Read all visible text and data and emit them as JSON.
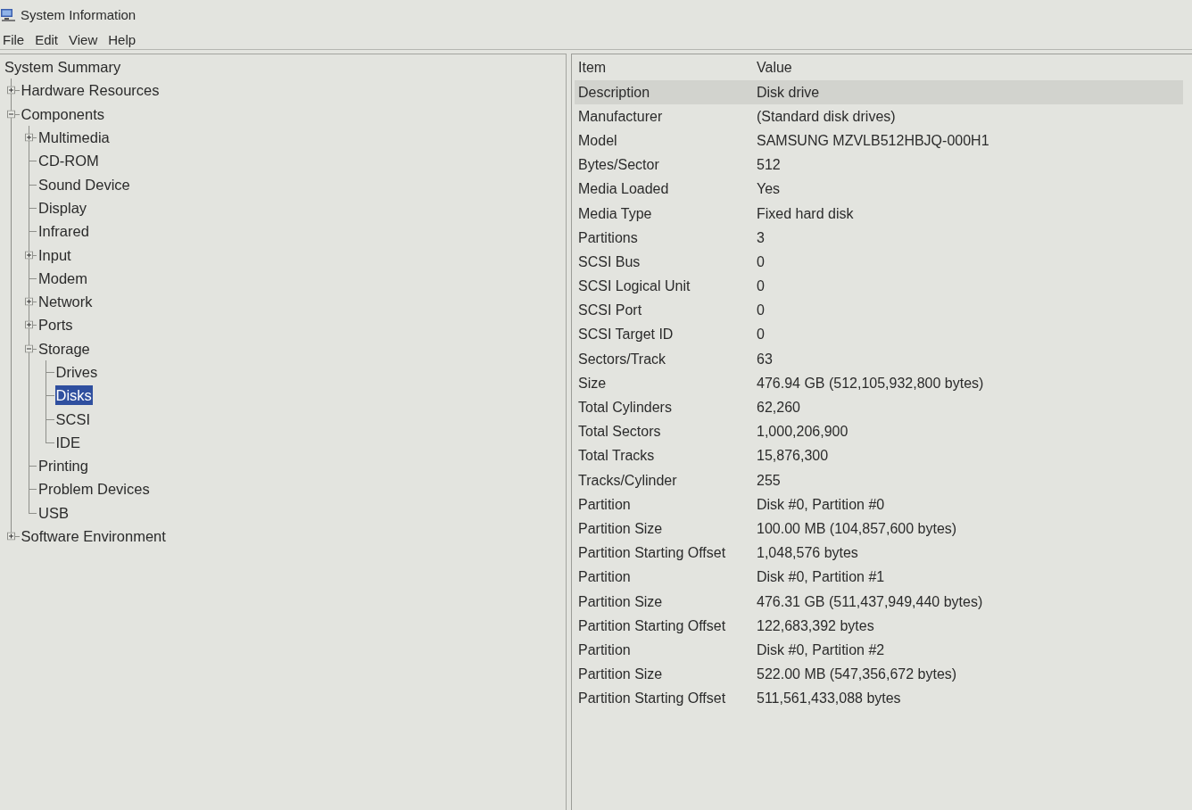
{
  "window": {
    "title": "System Information"
  },
  "menu_bar": [
    "File",
    "Edit",
    "View",
    "Help"
  ],
  "tree": [
    {
      "label": "System Summary",
      "selected": false,
      "children": [
        {
          "label": "Hardware Resources",
          "expanded": false,
          "selected": false
        },
        {
          "label": "Components",
          "expanded": true,
          "selected": false,
          "children": [
            {
              "label": "Multimedia",
              "expanded": false,
              "selected": false
            },
            {
              "label": "CD-ROM",
              "selected": false
            },
            {
              "label": "Sound Device",
              "selected": false
            },
            {
              "label": "Display",
              "selected": false
            },
            {
              "label": "Infrared",
              "selected": false
            },
            {
              "label": "Input",
              "expanded": false,
              "selected": false
            },
            {
              "label": "Modem",
              "selected": false
            },
            {
              "label": "Network",
              "expanded": false,
              "selected": false
            },
            {
              "label": "Ports",
              "expanded": false,
              "selected": false
            },
            {
              "label": "Storage",
              "expanded": true,
              "selected": false,
              "children": [
                {
                  "label": "Drives",
                  "selected": false
                },
                {
                  "label": "Disks",
                  "selected": true
                },
                {
                  "label": "SCSI",
                  "selected": false
                },
                {
                  "label": "IDE",
                  "selected": false
                }
              ]
            },
            {
              "label": "Printing",
              "selected": false
            },
            {
              "label": "Problem Devices",
              "selected": false
            },
            {
              "label": "USB",
              "selected": false
            }
          ]
        },
        {
          "label": "Software Environment",
          "expanded": false,
          "selected": false
        }
      ]
    }
  ],
  "table": {
    "columns": [
      "Item",
      "Value"
    ],
    "rows": [
      {
        "item": "Description",
        "value": "Disk drive",
        "selected": true
      },
      {
        "item": "Manufacturer",
        "value": "(Standard disk drives)",
        "selected": false
      },
      {
        "item": "Model",
        "value": "SAMSUNG MZVLB512HBJQ-000H1",
        "selected": false
      },
      {
        "item": "Bytes/Sector",
        "value": "512",
        "selected": false
      },
      {
        "item": "Media Loaded",
        "value": "Yes",
        "selected": false
      },
      {
        "item": "Media Type",
        "value": "Fixed hard disk",
        "selected": false
      },
      {
        "item": "Partitions",
        "value": "3",
        "selected": false
      },
      {
        "item": "SCSI Bus",
        "value": "0",
        "selected": false
      },
      {
        "item": "SCSI Logical Unit",
        "value": "0",
        "selected": false
      },
      {
        "item": "SCSI Port",
        "value": "0",
        "selected": false
      },
      {
        "item": "SCSI Target ID",
        "value": "0",
        "selected": false
      },
      {
        "item": "Sectors/Track",
        "value": "63",
        "selected": false
      },
      {
        "item": "Size",
        "value": "476.94 GB (512,105,932,800 bytes)",
        "selected": false
      },
      {
        "item": "Total Cylinders",
        "value": "62,260",
        "selected": false
      },
      {
        "item": "Total Sectors",
        "value": "1,000,206,900",
        "selected": false
      },
      {
        "item": "Total Tracks",
        "value": "15,876,300",
        "selected": false
      },
      {
        "item": "Tracks/Cylinder",
        "value": "255",
        "selected": false
      },
      {
        "item": "Partition",
        "value": "Disk #0, Partition #0",
        "selected": false
      },
      {
        "item": "Partition Size",
        "value": "100.00 MB (104,857,600 bytes)",
        "selected": false
      },
      {
        "item": "Partition Starting Offset",
        "value": "1,048,576 bytes",
        "selected": false
      },
      {
        "item": "Partition",
        "value": "Disk #0, Partition #1",
        "selected": false
      },
      {
        "item": "Partition Size",
        "value": "476.31 GB (511,437,949,440 bytes)",
        "selected": false
      },
      {
        "item": "Partition Starting Offset",
        "value": "122,683,392 bytes",
        "selected": false
      },
      {
        "item": "Partition",
        "value": "Disk #0, Partition #2",
        "selected": false
      },
      {
        "item": "Partition Size",
        "value": "522.00 MB (547,356,672 bytes)",
        "selected": false
      },
      {
        "item": "Partition Starting Offset",
        "value": "511,561,433,088 bytes",
        "selected": false
      }
    ]
  }
}
